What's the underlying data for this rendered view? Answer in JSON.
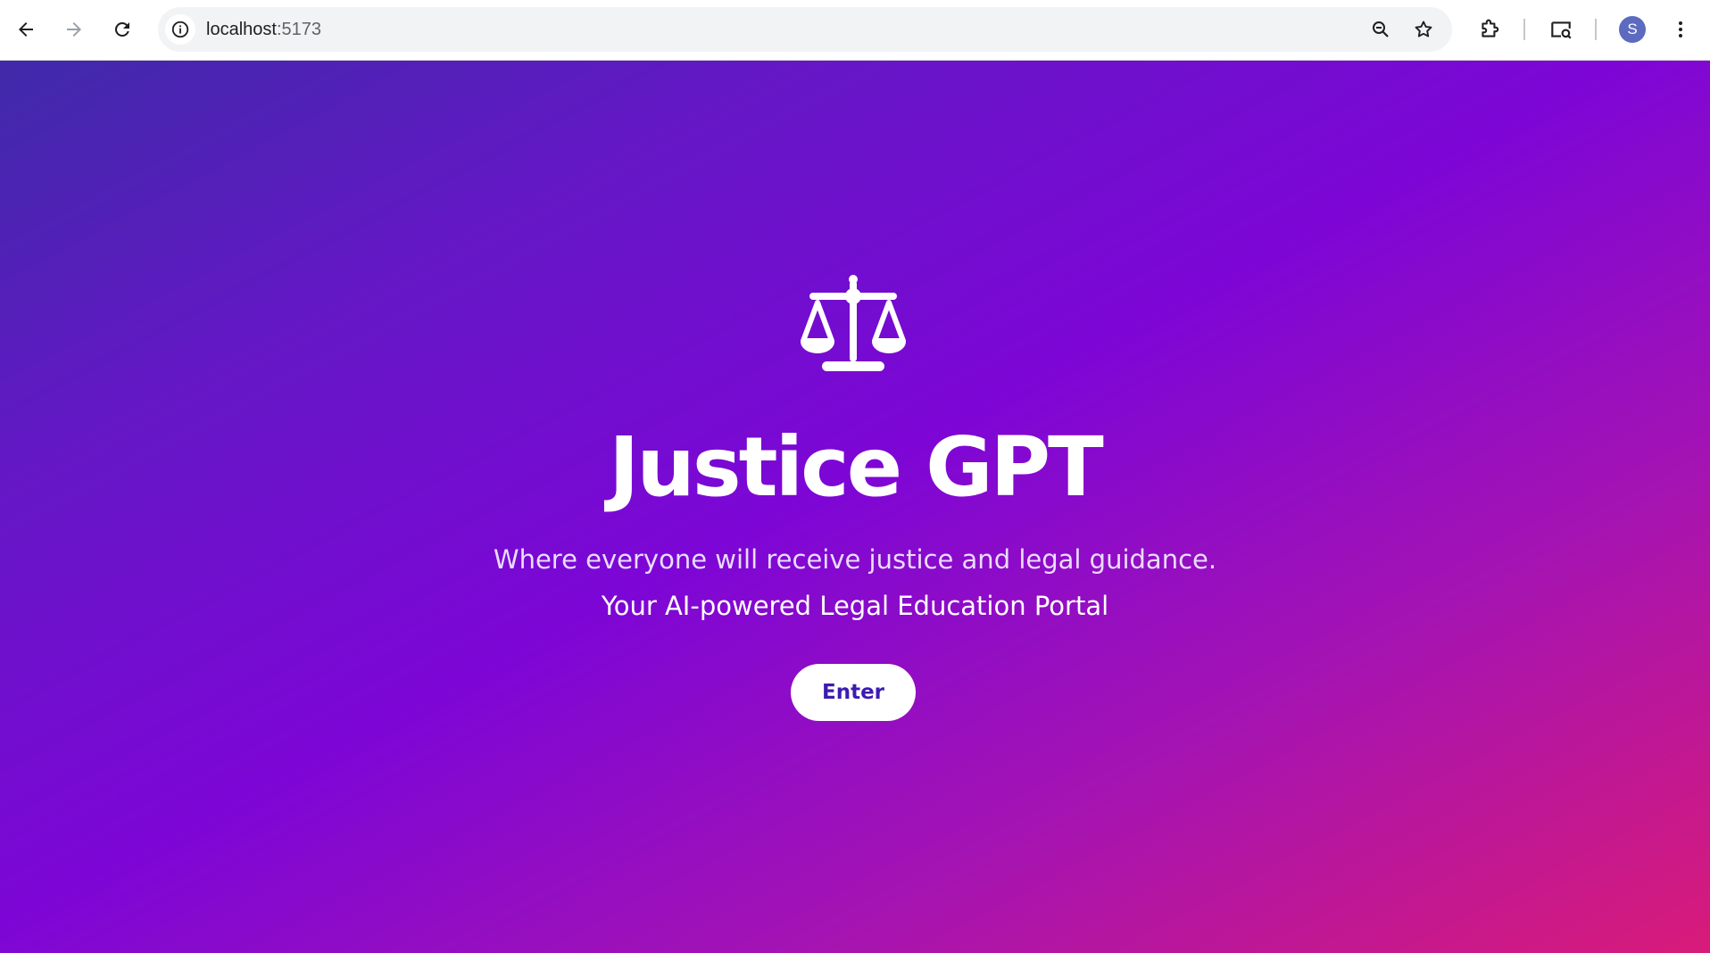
{
  "browser": {
    "url_host": "localhost",
    "url_port": ":5173",
    "avatar_letter": "S",
    "icons": [
      "back-arrow-icon",
      "forward-arrow-icon",
      "reload-icon",
      "site-info-icon",
      "zoom-icon",
      "bookmark-star-icon",
      "extensions-icon",
      "search-tab-icon",
      "more-vert-icon"
    ]
  },
  "hero": {
    "logo_icon": "scales-of-justice-icon",
    "title": "Justice GPT",
    "subtitle": "Where everyone will receive justice and legal guidance.",
    "tagline": "Your AI-powered Legal Education Portal",
    "enter_label": "Enter"
  },
  "colors": {
    "gradient_start": "#3f2aa9",
    "gradient_mid": "#7d06d6",
    "gradient_end": "#d81b79",
    "button_text": "#3d1bb0"
  }
}
